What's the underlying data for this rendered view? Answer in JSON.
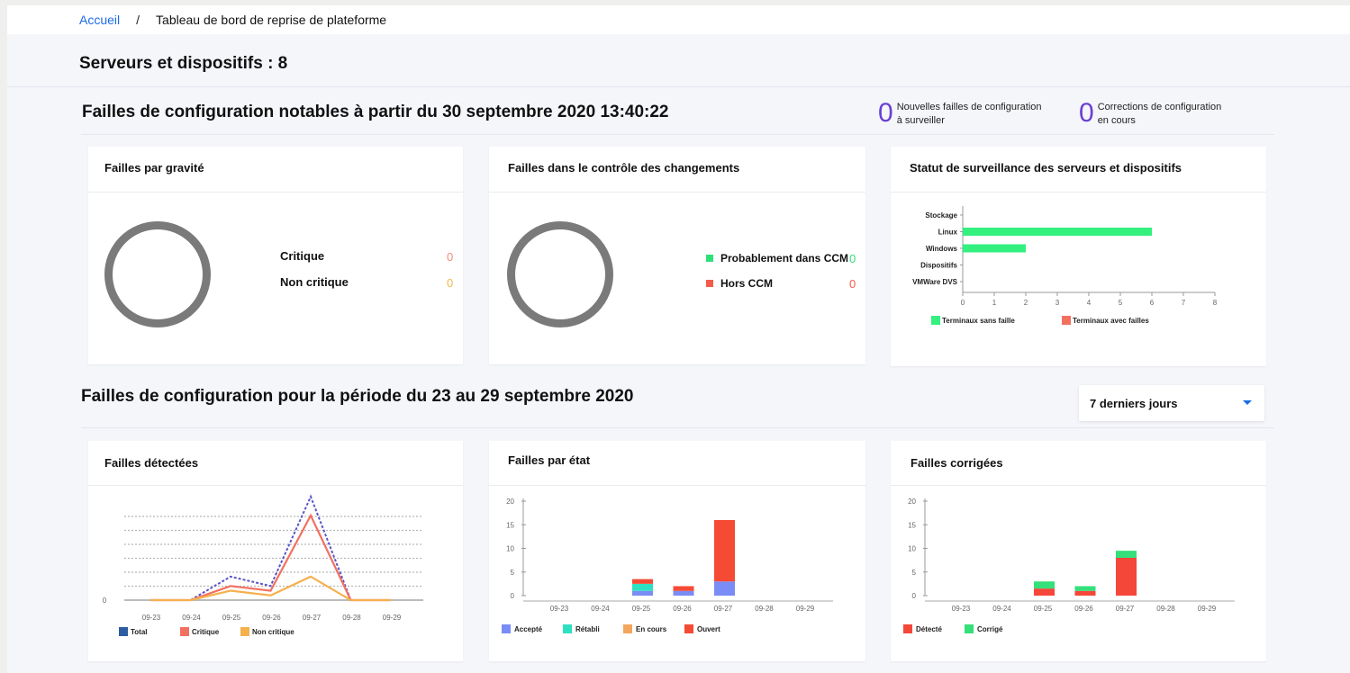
{
  "breadcrumb": {
    "home": "Accueil",
    "separator": "/",
    "current": "Tableau de bord de reprise de plateforme"
  },
  "page_title": "Serveurs et dispositifs : 8",
  "section1": {
    "title": "Failles de configuration notables à partir du 30 septembre 2020 13:40:22",
    "kpis": [
      {
        "value": "0",
        "line1": "Nouvelles failles de configuration",
        "line2": "à surveiller"
      },
      {
        "value": "0",
        "line1": "Corrections de configuration",
        "line2": "en cours"
      }
    ]
  },
  "severity_card": {
    "title": "Failles par gravité",
    "legend": [
      {
        "label": "Critique",
        "value": "0",
        "color": "#f28a7c"
      },
      {
        "label": "Non critique",
        "value": "0",
        "color": "#f5b74e"
      }
    ]
  },
  "ccm_card": {
    "title": "Failles dans le contrôle des changements",
    "legend": [
      {
        "label": "Probablement dans CCM",
        "value": "0",
        "color": "#2fe07a"
      },
      {
        "label": "Hors CCM",
        "value": "0",
        "color": "#f45b4a"
      }
    ]
  },
  "monitoring_card": {
    "title": "Statut de surveillance des serveurs et dispositifs",
    "chart_data": {
      "type": "bar",
      "orientation": "horizontal",
      "categories": [
        "Stockage",
        "Linux",
        "Windows",
        "Dispositifs",
        "VMWare DVS"
      ],
      "series": [
        {
          "name": "Terminaux sans faille",
          "values": [
            0,
            6,
            2,
            0,
            0
          ],
          "color": "#33f07f"
        },
        {
          "name": "Terminaux avec failles",
          "values": [
            0,
            0,
            0,
            0,
            0
          ],
          "color": "#f2705f"
        }
      ],
      "xticks": [
        "0",
        "1",
        "2",
        "3",
        "4",
        "5",
        "6",
        "7",
        "8"
      ],
      "xlim": [
        0,
        8
      ]
    }
  },
  "section2": {
    "title": "Failles de configuration pour la période du 23 au 29 septembre 2020"
  },
  "period_dropdown": {
    "value": "7 derniers jours"
  },
  "detected_card": {
    "title": "Failles détectées",
    "chart_data": {
      "type": "line",
      "x": [
        "09-23",
        "09-24",
        "09-25",
        "09-26",
        "09-27",
        "09-28",
        "09-29"
      ],
      "yticks": [
        "0"
      ],
      "ylim": [
        0,
        22
      ],
      "series": [
        {
          "name": "Total",
          "values": [
            0,
            0,
            5,
            3,
            22,
            0,
            0
          ],
          "color": "#5a55c8"
        },
        {
          "name": "Critique",
          "values": [
            0,
            0,
            3,
            2,
            18,
            0,
            0
          ],
          "color": "#f2705f"
        },
        {
          "name": "Non critique",
          "values": [
            0,
            0,
            2,
            1,
            5,
            0,
            0
          ],
          "color": "#f5b04e"
        }
      ],
      "legend_colors": [
        "#2d5ca0",
        "#f2705f",
        "#f5b04e"
      ]
    }
  },
  "state_card": {
    "title": "Failles par état",
    "chart_data": {
      "type": "bar",
      "stacked": true,
      "categories": [
        "09-23",
        "09-24",
        "09-25",
        "09-26",
        "09-27",
        "09-28",
        "09-29"
      ],
      "yticks": [
        "0",
        "5",
        "10",
        "15",
        "20"
      ],
      "ylim": [
        0,
        20
      ],
      "series": [
        {
          "name": "Accepté",
          "values": [
            0,
            0,
            1,
            1,
            3,
            0,
            0
          ],
          "color": "#7a8cf5"
        },
        {
          "name": "Rétabli",
          "values": [
            0,
            0,
            1.5,
            0,
            0,
            0,
            0
          ],
          "color": "#2ee0c2"
        },
        {
          "name": "En cours",
          "values": [
            0,
            0,
            0,
            0,
            0,
            0,
            0
          ],
          "color": "#f5a65e"
        },
        {
          "name": "Ouvert",
          "values": [
            0,
            0,
            1,
            1,
            13,
            0,
            0
          ],
          "color": "#f54a34"
        }
      ]
    }
  },
  "fixed_card": {
    "title": "Failles corrigées",
    "chart_data": {
      "type": "bar",
      "stacked": true,
      "categories": [
        "09-23",
        "09-24",
        "09-25",
        "09-26",
        "09-27",
        "09-28",
        "09-29"
      ],
      "yticks": [
        "0",
        "5",
        "10",
        "15",
        "20"
      ],
      "ylim": [
        0,
        20
      ],
      "series": [
        {
          "name": "Détecté",
          "values": [
            0,
            0,
            1.5,
            1,
            8,
            0,
            0
          ],
          "color": "#f5463a"
        },
        {
          "name": "Corrigé",
          "values": [
            0,
            0,
            1.5,
            1,
            1.5,
            0,
            0
          ],
          "color": "#33e07a"
        }
      ]
    }
  }
}
